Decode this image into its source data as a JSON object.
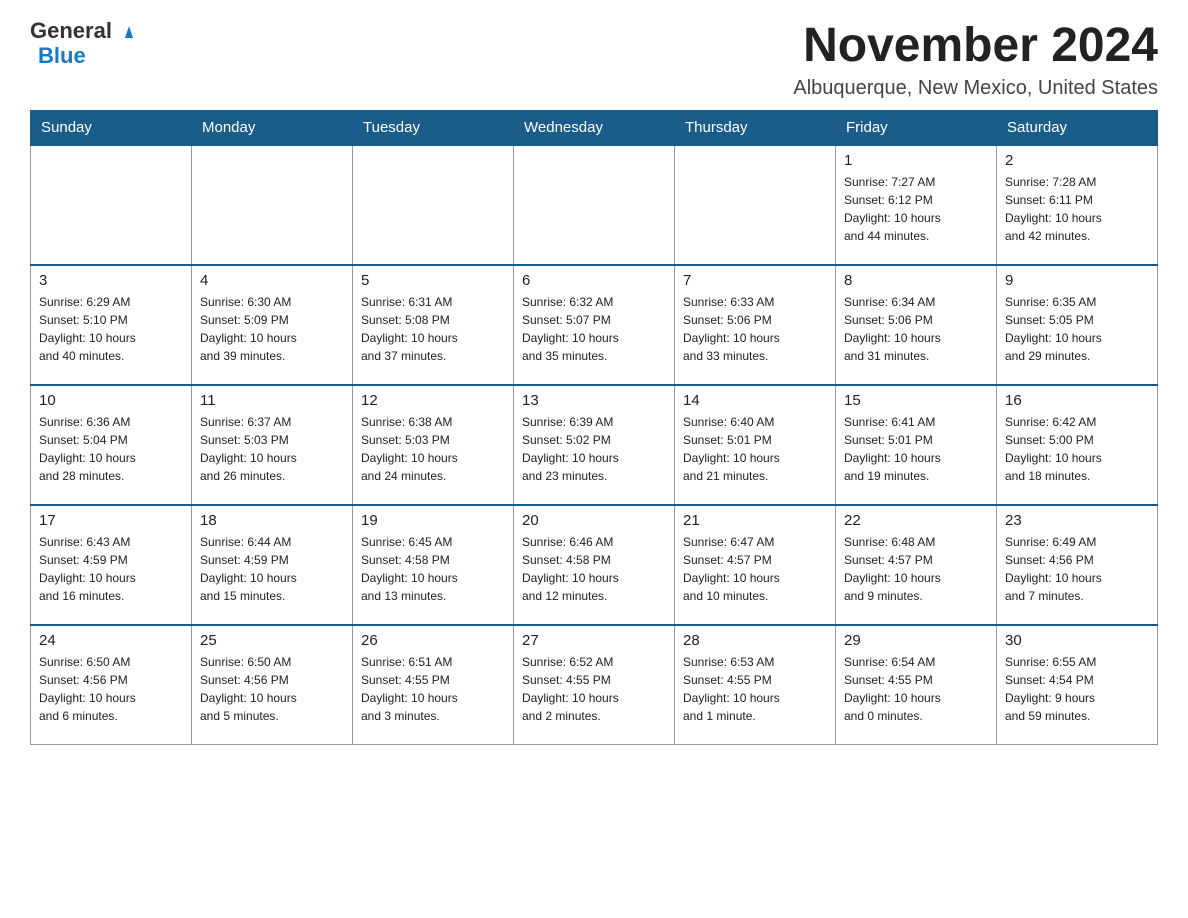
{
  "logo": {
    "general": "General",
    "blue": "Blue",
    "triangle": "▲"
  },
  "title": "November 2024",
  "subtitle": "Albuquerque, New Mexico, United States",
  "days_of_week": [
    "Sunday",
    "Monday",
    "Tuesday",
    "Wednesday",
    "Thursday",
    "Friday",
    "Saturday"
  ],
  "weeks": [
    [
      {
        "day": "",
        "info": ""
      },
      {
        "day": "",
        "info": ""
      },
      {
        "day": "",
        "info": ""
      },
      {
        "day": "",
        "info": ""
      },
      {
        "day": "",
        "info": ""
      },
      {
        "day": "1",
        "info": "Sunrise: 7:27 AM\nSunset: 6:12 PM\nDaylight: 10 hours\nand 44 minutes."
      },
      {
        "day": "2",
        "info": "Sunrise: 7:28 AM\nSunset: 6:11 PM\nDaylight: 10 hours\nand 42 minutes."
      }
    ],
    [
      {
        "day": "3",
        "info": "Sunrise: 6:29 AM\nSunset: 5:10 PM\nDaylight: 10 hours\nand 40 minutes."
      },
      {
        "day": "4",
        "info": "Sunrise: 6:30 AM\nSunset: 5:09 PM\nDaylight: 10 hours\nand 39 minutes."
      },
      {
        "day": "5",
        "info": "Sunrise: 6:31 AM\nSunset: 5:08 PM\nDaylight: 10 hours\nand 37 minutes."
      },
      {
        "day": "6",
        "info": "Sunrise: 6:32 AM\nSunset: 5:07 PM\nDaylight: 10 hours\nand 35 minutes."
      },
      {
        "day": "7",
        "info": "Sunrise: 6:33 AM\nSunset: 5:06 PM\nDaylight: 10 hours\nand 33 minutes."
      },
      {
        "day": "8",
        "info": "Sunrise: 6:34 AM\nSunset: 5:06 PM\nDaylight: 10 hours\nand 31 minutes."
      },
      {
        "day": "9",
        "info": "Sunrise: 6:35 AM\nSunset: 5:05 PM\nDaylight: 10 hours\nand 29 minutes."
      }
    ],
    [
      {
        "day": "10",
        "info": "Sunrise: 6:36 AM\nSunset: 5:04 PM\nDaylight: 10 hours\nand 28 minutes."
      },
      {
        "day": "11",
        "info": "Sunrise: 6:37 AM\nSunset: 5:03 PM\nDaylight: 10 hours\nand 26 minutes."
      },
      {
        "day": "12",
        "info": "Sunrise: 6:38 AM\nSunset: 5:03 PM\nDaylight: 10 hours\nand 24 minutes."
      },
      {
        "day": "13",
        "info": "Sunrise: 6:39 AM\nSunset: 5:02 PM\nDaylight: 10 hours\nand 23 minutes."
      },
      {
        "day": "14",
        "info": "Sunrise: 6:40 AM\nSunset: 5:01 PM\nDaylight: 10 hours\nand 21 minutes."
      },
      {
        "day": "15",
        "info": "Sunrise: 6:41 AM\nSunset: 5:01 PM\nDaylight: 10 hours\nand 19 minutes."
      },
      {
        "day": "16",
        "info": "Sunrise: 6:42 AM\nSunset: 5:00 PM\nDaylight: 10 hours\nand 18 minutes."
      }
    ],
    [
      {
        "day": "17",
        "info": "Sunrise: 6:43 AM\nSunset: 4:59 PM\nDaylight: 10 hours\nand 16 minutes."
      },
      {
        "day": "18",
        "info": "Sunrise: 6:44 AM\nSunset: 4:59 PM\nDaylight: 10 hours\nand 15 minutes."
      },
      {
        "day": "19",
        "info": "Sunrise: 6:45 AM\nSunset: 4:58 PM\nDaylight: 10 hours\nand 13 minutes."
      },
      {
        "day": "20",
        "info": "Sunrise: 6:46 AM\nSunset: 4:58 PM\nDaylight: 10 hours\nand 12 minutes."
      },
      {
        "day": "21",
        "info": "Sunrise: 6:47 AM\nSunset: 4:57 PM\nDaylight: 10 hours\nand 10 minutes."
      },
      {
        "day": "22",
        "info": "Sunrise: 6:48 AM\nSunset: 4:57 PM\nDaylight: 10 hours\nand 9 minutes."
      },
      {
        "day": "23",
        "info": "Sunrise: 6:49 AM\nSunset: 4:56 PM\nDaylight: 10 hours\nand 7 minutes."
      }
    ],
    [
      {
        "day": "24",
        "info": "Sunrise: 6:50 AM\nSunset: 4:56 PM\nDaylight: 10 hours\nand 6 minutes."
      },
      {
        "day": "25",
        "info": "Sunrise: 6:50 AM\nSunset: 4:56 PM\nDaylight: 10 hours\nand 5 minutes."
      },
      {
        "day": "26",
        "info": "Sunrise: 6:51 AM\nSunset: 4:55 PM\nDaylight: 10 hours\nand 3 minutes."
      },
      {
        "day": "27",
        "info": "Sunrise: 6:52 AM\nSunset: 4:55 PM\nDaylight: 10 hours\nand 2 minutes."
      },
      {
        "day": "28",
        "info": "Sunrise: 6:53 AM\nSunset: 4:55 PM\nDaylight: 10 hours\nand 1 minute."
      },
      {
        "day": "29",
        "info": "Sunrise: 6:54 AM\nSunset: 4:55 PM\nDaylight: 10 hours\nand 0 minutes."
      },
      {
        "day": "30",
        "info": "Sunrise: 6:55 AM\nSunset: 4:54 PM\nDaylight: 9 hours\nand 59 minutes."
      }
    ]
  ]
}
